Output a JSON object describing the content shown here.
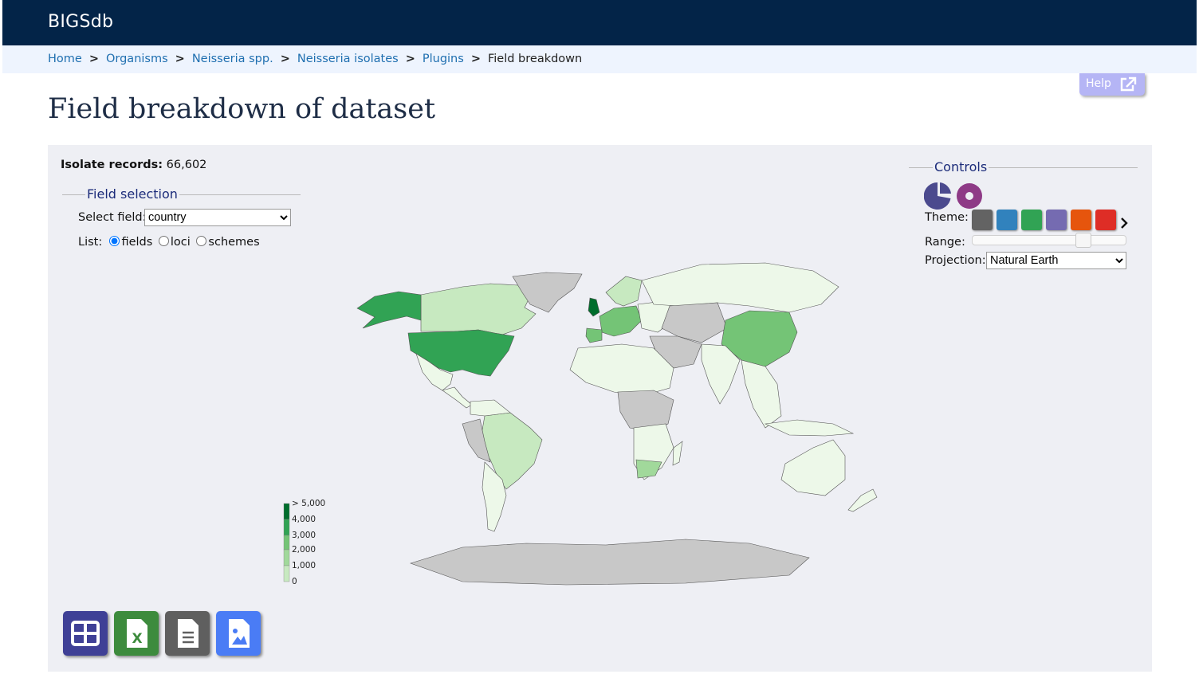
{
  "site": {
    "title": "BIGSdb"
  },
  "breadcrumb": {
    "items": [
      "Home",
      "Organisms",
      "Neisseria spp.",
      "Neisseria isolates",
      "Plugins"
    ],
    "separator": ">",
    "current": "Field breakdown"
  },
  "help": {
    "label": "Help",
    "icon": "external-link-icon"
  },
  "page": {
    "title": "Field breakdown of dataset"
  },
  "records": {
    "label": "Isolate records:",
    "value": "66,602"
  },
  "field_selection": {
    "legend": "Field selection",
    "select_label": "Select field:",
    "selected": "country",
    "list_label": "List:",
    "options": [
      "fields",
      "loci",
      "schemes"
    ],
    "checked": "fields"
  },
  "controls": {
    "legend": "Controls",
    "chart_icons": [
      "pie-chart-icon",
      "donut-chart-icon"
    ],
    "theme_label": "Theme:",
    "themes": [
      {
        "name": "grey",
        "color": "#636363"
      },
      {
        "name": "blue",
        "color": "#3182bd"
      },
      {
        "name": "green",
        "color": "#31a354"
      },
      {
        "name": "purple",
        "color": "#756bb1"
      },
      {
        "name": "orange",
        "color": "#e6550d"
      },
      {
        "name": "red",
        "color": "#de2d26"
      }
    ],
    "more_icon": "chevron-right-icon",
    "range_label": "Range:",
    "range_value": 0.75,
    "projection_label": "Projection:",
    "projection": "Natural Earth"
  },
  "map_legend": {
    "labels": [
      "> 5,000",
      "4,000",
      "3,000",
      "2,000",
      "1,000",
      "0"
    ],
    "colors": [
      "#006d2c",
      "#31a354",
      "#74c476",
      "#a1d99b",
      "#c7e9c0",
      "#edf8e9"
    ]
  },
  "export_buttons": [
    {
      "name": "table-export-button",
      "icon": "table-icon",
      "color": "#3f4096"
    },
    {
      "name": "excel-export-button",
      "icon": "excel-icon",
      "color": "#3d8b3d"
    },
    {
      "name": "text-export-button",
      "icon": "text-file-icon",
      "color": "#5f5f5f"
    },
    {
      "name": "image-export-button",
      "icon": "image-file-icon",
      "color": "#4a7cf5"
    }
  ],
  "colors": {
    "header_bg": "#032448",
    "breadcrumb_bg": "#eef4fe",
    "panel_bg": "#eeeff4",
    "no_data": "#c8c8c8"
  }
}
